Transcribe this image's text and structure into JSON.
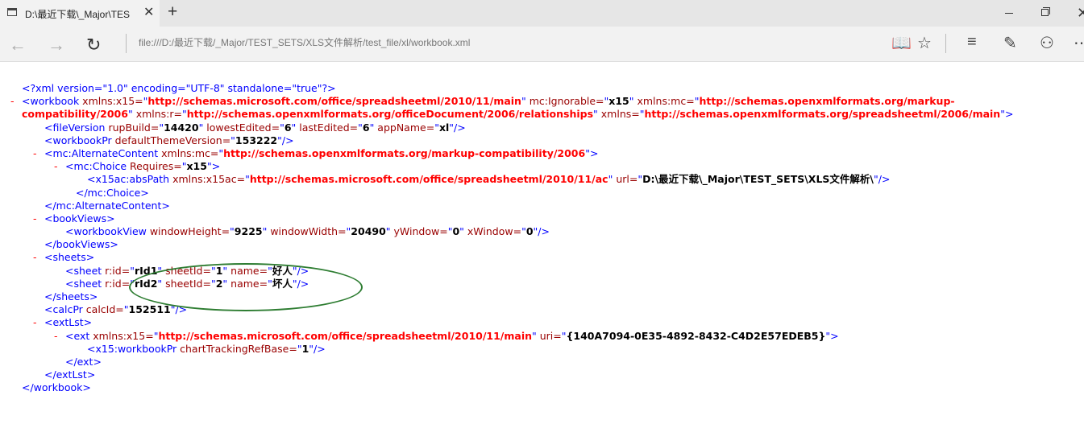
{
  "tab": {
    "title": "D:\\最近下载\\_Major\\TES"
  },
  "address_bar": {
    "url": "file:///D:/最近下载/_Major/TEST_SETS/XLS文件解析/test_file/xl/workbook.xml"
  },
  "xml": {
    "decl": {
      "text": "<?xml version=\"1.0\" encoding=\"UTF-8\" standalone=\"true\"?>"
    },
    "workbook": {
      "ns_x15": "http://schemas.microsoft.com/office/spreadsheetml/2010/11/main",
      "ignorable": "x15",
      "ns_mc": "http://schemas.openxmlformats.org/markup-compatibility/2006",
      "ns_r": "http://schemas.openxmlformats.org/officeDocument/2006/relationships",
      "ns": "http://schemas.openxmlformats.org/spreadsheetml/2006/main"
    },
    "fileVersion": {
      "rupBuild": "14420",
      "lowestEdited": "6",
      "lastEdited": "6",
      "appName": "xl"
    },
    "workbookPr": {
      "defaultThemeVersion": "153222"
    },
    "alternateContent": {
      "ns_mc": "http://schemas.openxmlformats.org/markup-compatibility/2006"
    },
    "choice": {
      "requires": "x15"
    },
    "absPath": {
      "ns": "http://schemas.microsoft.com/office/spreadsheetml/2010/11/ac",
      "url": "D:\\最近下载\\_Major\\TEST_SETS\\XLS文件解析\\"
    },
    "workbookView": {
      "windowHeight": "9225",
      "windowWidth": "20490",
      "yWindow": "0",
      "xWindow": "0"
    },
    "sheets": [
      {
        "rid": "rId1",
        "sheetId": "1",
        "name": "好人"
      },
      {
        "rid": "rId2",
        "sheetId": "2",
        "name": "坏人"
      }
    ],
    "calcPr": {
      "calcId": "152511"
    },
    "ext": {
      "ns": "http://schemas.microsoft.com/office/spreadsheetml/2010/11/main",
      "uri": "{140A7094-0E35-4892-8432-C4D2E57EDEB5}"
    },
    "x15WorkbookPr": {
      "chartTrackingRefBase": "1"
    }
  },
  "colors": {
    "tag": "#0000ff",
    "attr": "#990000",
    "highlight": "#2e7d32"
  }
}
